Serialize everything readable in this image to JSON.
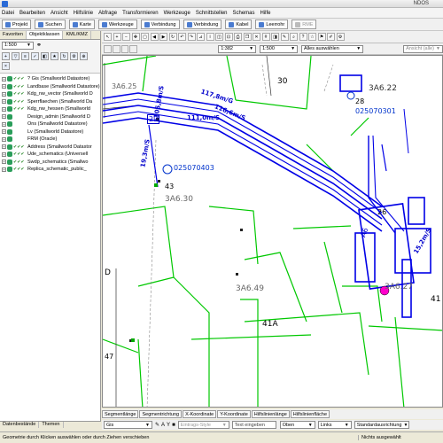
{
  "app": {
    "title": "NDOS"
  },
  "menu": [
    "Datei",
    "Bearbeiten",
    "Ansicht",
    "Hilfslinie",
    "Abfrage",
    "Transformieren",
    "Werkzeuge",
    "Schnittstellen",
    "Schemas",
    "Hilfe"
  ],
  "toolbar": {
    "projekt": "Projekt",
    "suchen": "Suchen",
    "karte": "Karte",
    "werkzeuge": "Werkzeuge",
    "verbindung1": "Verbindung",
    "verbindung2": "Verbindung",
    "kabel": "Kabel",
    "leerrohr": "Leerrohr",
    "rme": "RME"
  },
  "left_panel": {
    "tabs": [
      "Favoriten",
      "Objektklassen",
      "KML/KMZ"
    ],
    "scale": "1:500",
    "datasources": [
      {
        "label": "? Gis (Smallworld Datastore)",
        "checks": "✔✔✔"
      },
      {
        "label": "Landbase (Smallworld Datastore)",
        "checks": "✔✔✔"
      },
      {
        "label": "Kdg_nw_vector (Smallworld D",
        "checks": "✔✔✔"
      },
      {
        "label": "Sperrflaechen (Smallworld Da",
        "checks": "✔✔✔"
      },
      {
        "label": "Kdg_nw_hessen (Smallworld",
        "checks": "✔✔✔"
      },
      {
        "label": "Design_admin (Smallworld D",
        "checks": ""
      },
      {
        "label": "Ons (Smallworld Datastore)",
        "checks": ""
      },
      {
        "label": "Lv (Smallworld Datastore)",
        "checks": ""
      },
      {
        "label": "FRM (Oracle)",
        "checks": ""
      },
      {
        "label": "Address (Smallworld Datastor",
        "checks": "✔✔✔"
      },
      {
        "label": "Ude_schematics (Universell",
        "checks": "✔✔✔"
      },
      {
        "label": "Swdp_schematics (Smallwo",
        "checks": "✔✔✔"
      },
      {
        "label": "Replica_schematic_public_",
        "checks": "✔✔✔"
      }
    ],
    "bottom_tabs": [
      "Datenbestände",
      "Themen"
    ]
  },
  "mapbar": {
    "scale1": "1:382",
    "scale2": "1:500",
    "select_all": "Alles auswählen",
    "view": "Ansicht (alle)"
  },
  "map": {
    "labels": [
      {
        "text": "30",
        "color": "#333"
      },
      {
        "text": "28",
        "color": "#333"
      },
      {
        "text": "3A6.22",
        "color": "#333"
      },
      {
        "text": "025070301",
        "color": "#0033cc"
      },
      {
        "text": "117,8m/G",
        "color": "#0000cc"
      },
      {
        "text": "116,6m/S",
        "color": "#0000cc"
      },
      {
        "text": "111,0m/S",
        "color": "#0000cc"
      },
      {
        "text": "105,8m/S",
        "color": "#0000cc"
      },
      {
        "text": "29",
        "color": "#0000cc"
      },
      {
        "text": "19,3m/S",
        "color": "#0000cc"
      },
      {
        "text": "025070403",
        "color": "#0033cc"
      },
      {
        "text": "43",
        "color": "#333"
      },
      {
        "text": "3A6.30",
        "color": "#666"
      },
      {
        "text": "3A6.49",
        "color": "#666"
      },
      {
        "text": "41A",
        "color": "#333"
      },
      {
        "text": "3A6.27",
        "color": "#666"
      },
      {
        "text": "41",
        "color": "#333"
      },
      {
        "text": "47",
        "color": "#333"
      },
      {
        "text": "26",
        "color": "#333"
      },
      {
        "text": "A6",
        "color": "#0000cc"
      },
      {
        "text": "15,2m/S",
        "color": "#0000cc"
      },
      {
        "text": "D",
        "color": "#333"
      },
      {
        "text": "3A6.25",
        "color": "#666"
      }
    ]
  },
  "bottom_tabs1": [
    "Segmentlänge",
    "Segmentrichtung",
    "X-Koordinate",
    "Y-Koordinate",
    "Hilfslinienlänge",
    "Hilfslinienfläche"
  ],
  "bottom_bar2": {
    "layer": "Gis",
    "style": "Eintrags-Style",
    "text_input": "Text eingeben",
    "pos1": "Oben",
    "pos2": "Links",
    "orientation": "Standardausrichtung"
  },
  "status": {
    "hint": "Geometrie durch Klicken auswählen oder durch Ziehen verschieben",
    "selection": "Nichts ausgewählt"
  },
  "colors": {
    "cable_blue": "#0000e6",
    "parcel_green": "#00c800",
    "highlight": "#ff00cc"
  }
}
